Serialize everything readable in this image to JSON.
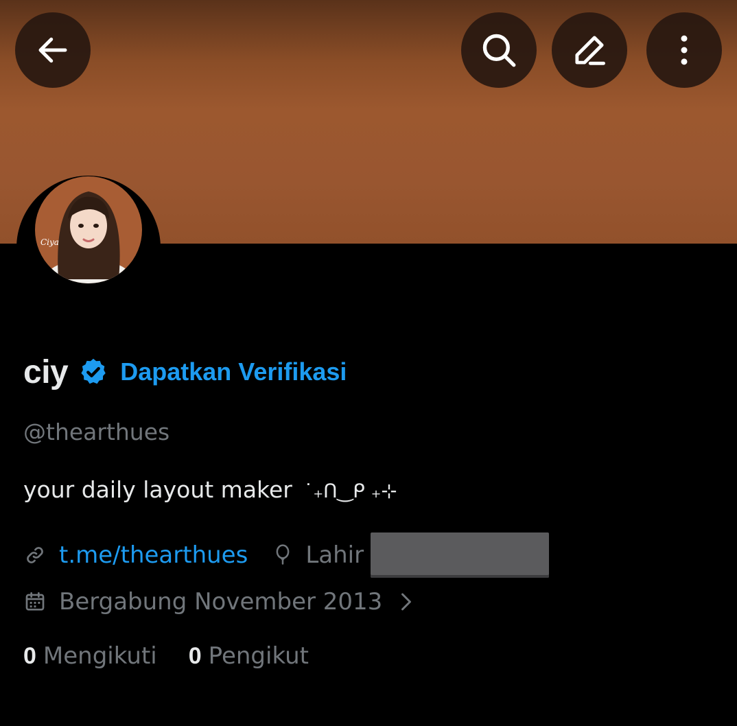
{
  "header": {
    "back_icon": "arrow-left-icon",
    "search_icon": "search-icon",
    "edit_icon": "pencil-icon",
    "more_icon": "more-vertical-icon",
    "banner_color": "#9c582f"
  },
  "profile": {
    "display_name": "ciy",
    "verified_icon": "verified-badge-icon",
    "get_verified_label": "Dapatkan Verifikasi",
    "handle": "@thearthues",
    "bio_text": "your daily layout maker",
    "bio_decoration": "˙₊ᑎ‿ᑭ ₊⊹",
    "link_icon": "link-icon",
    "link_text": "t.me/thearthues",
    "birthday_icon": "balloon-icon",
    "birthday_label": "Lahir",
    "joined_icon": "calendar-icon",
    "joined_text": "Bergabung November 2013",
    "joined_chevron_icon": "chevron-right-icon"
  },
  "stats": {
    "following_count": "0",
    "following_label": "Mengikuti",
    "followers_count": "0",
    "followers_label": "Pengikut"
  },
  "colors": {
    "accent": "#1d9bf0",
    "secondary_text": "#71767b",
    "primary_text": "#e7e9ea",
    "background": "#000000"
  }
}
